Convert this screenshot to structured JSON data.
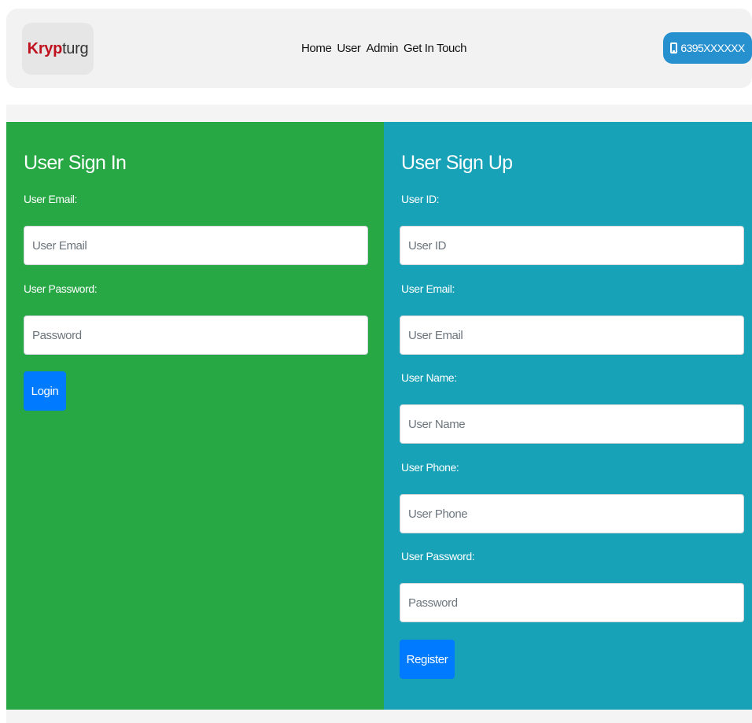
{
  "brand": {
    "part1": "Kryp",
    "part2": "turg"
  },
  "nav": {
    "links": [
      "Home",
      "User",
      "Admin",
      "Get In Touch"
    ]
  },
  "contact": {
    "phone": "6395XXXXXX",
    "icon": "mobile-phone-icon"
  },
  "signin": {
    "title": "User Sign In",
    "email_label": "User Email:",
    "email_placeholder": "User Email",
    "password_label": "User Password:",
    "password_placeholder": "Password",
    "button": "Login"
  },
  "signup": {
    "title": "User Sign Up",
    "id_label": "User ID:",
    "id_placeholder": "User ID",
    "email_label": "User Email:",
    "email_placeholder": "User Email",
    "name_label": "User Name:",
    "name_placeholder": "User Name",
    "phone_label": "User Phone:",
    "phone_placeholder": "User Phone",
    "password_label": "User Password:",
    "password_placeholder": "Password",
    "button": "Register"
  },
  "colors": {
    "signin_panel": "#28a745",
    "signup_panel": "#17a2b8",
    "primary_button": "#007bff",
    "brand_red": "#c0111f",
    "phone_button": "#2790cf"
  }
}
